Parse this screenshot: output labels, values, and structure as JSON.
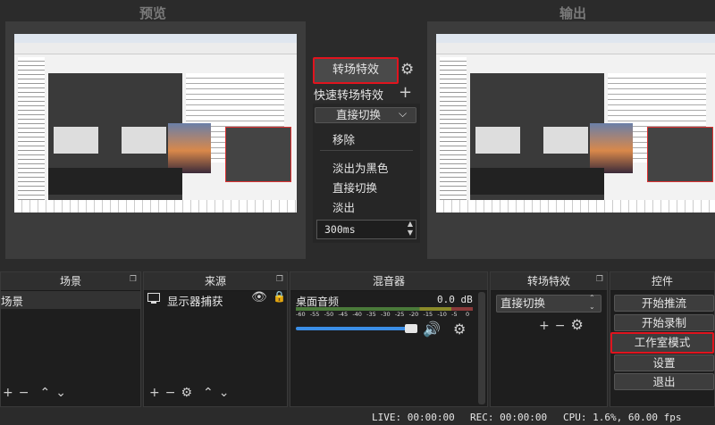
{
  "preview": {
    "title": "预览"
  },
  "output": {
    "title": "输出"
  },
  "transition_panel": {
    "transition_button": "转场特效",
    "quick_transition_label": "快速转场特效",
    "select_value": "直接切换",
    "menu_items": [
      "移除",
      "淡出为黑色",
      "直接切换",
      "淡出"
    ],
    "duration": "300ms"
  },
  "docks": {
    "scenes": {
      "title": "场景",
      "items": [
        "场景"
      ]
    },
    "sources": {
      "title": "来源",
      "items": [
        {
          "label": "显示器捕获",
          "icon": "monitor-icon"
        }
      ]
    },
    "mixer": {
      "title": "混音器",
      "channel": "桌面音频",
      "db": "0.0 dB",
      "ticks": [
        "-60",
        "-55",
        "-50",
        "-45",
        "-40",
        "-35",
        "-30",
        "-25",
        "-20",
        "-15",
        "-10",
        "-5",
        "0"
      ],
      "volume_level": 0.93
    },
    "transitions": {
      "title": "转场特效",
      "select_value": "直接切换"
    },
    "controls": {
      "title": "控件",
      "buttons": [
        "开始推流",
        "开始录制",
        "工作室模式",
        "设置",
        "退出"
      ]
    }
  },
  "status_bar": {
    "live": "LIVE: 00:00:00",
    "rec": "REC: 00:00:00",
    "cpu": "CPU: 1.6%, 60.00 fps"
  },
  "colors": {
    "highlight": "#e0141e",
    "accent": "#3b8ee6"
  }
}
